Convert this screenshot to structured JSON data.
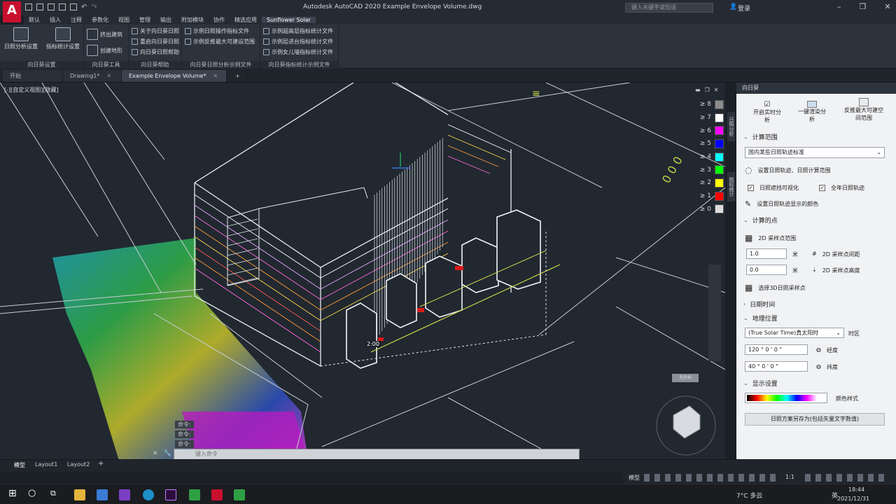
{
  "app": {
    "title": "Autodesk AutoCAD 2020    Example Envelope Volume.dwg",
    "logo_letter": "A",
    "search_placeholder": "键入关键字或短语",
    "login": "登录"
  },
  "menu": [
    "默认",
    "插入",
    "注释",
    "参数化",
    "视图",
    "管理",
    "输出",
    "附加模块",
    "协作",
    "精选应用",
    "Sunflower Solar"
  ],
  "ribbon": {
    "panel1": {
      "title": "向日葵设置",
      "btn1": "日照分析设置",
      "btn2": "指标统计设置"
    },
    "panel2": {
      "title": "向日葵工具",
      "btn1": "挤出建筑",
      "btn2": "创建地形"
    },
    "panel3": {
      "title": "向日葵帮助",
      "items": [
        "关于向日葵日照",
        "重启向日葵日照",
        "向日葵日照帮助"
      ]
    },
    "panel4": {
      "title": "向日葵日照分析示例文件",
      "items": [
        "示例日照操作指标文件",
        "示例反推最大可建设范围"
      ]
    },
    "panel5": {
      "title": "向日葵指标统计示例文件",
      "items": [
        "示例超高层指标统计文件",
        "示例层进台指标统计文件",
        "示例女儿墙指标统计文件"
      ]
    }
  },
  "tabs": [
    {
      "label": "开始",
      "active": false
    },
    {
      "label": "Drawing1*",
      "active": false
    },
    {
      "label": "Example Envelope Volume*",
      "active": true
    }
  ],
  "viewport": {
    "view_label": "[-][自定义视图][隐藏]",
    "time_label": "2:00",
    "nav_label": "无坐标",
    "legend": [
      {
        "label": "≥ 8",
        "color": "#8c8c8c"
      },
      {
        "label": "≥ 7",
        "color": "#ffffff"
      },
      {
        "label": "≥ 6",
        "color": "#ff00ff"
      },
      {
        "label": "≥ 5",
        "color": "#0000ff"
      },
      {
        "label": "≥ 4",
        "color": "#00ffff"
      },
      {
        "label": "≥ 3",
        "color": "#00ff00"
      },
      {
        "label": "≥ 2",
        "color": "#ffff00"
      },
      {
        "label": "≥ 1",
        "color": "#ff0000"
      },
      {
        "label": "≥ 0",
        "color": "#dcdcdc"
      }
    ]
  },
  "command": {
    "history": [
      "命令:",
      "命令:",
      "命令:"
    ],
    "placeholder": "键入命令"
  },
  "layout_tabs": [
    "模型",
    "Layout1",
    "Layout2"
  ],
  "status": {
    "model": "模型",
    "scale": "1:1"
  },
  "side_panel": {
    "title": "向日葵",
    "vtabs": [
      "日照分析",
      "指标统计"
    ],
    "top_buttons": [
      "开启实时分析",
      "一键渲染分析",
      "反推最大可建空间范围"
    ],
    "sec_calc_range": "计算范围",
    "standard_select": "国内某些日照轨迹标准",
    "set_track": "设置日照轨迹、日照计算范围",
    "track_visible": "日照遮挡可视化",
    "full_year": "全年日照轨迹",
    "set_color": "设置日照轨迹显示的颜色",
    "sec_points": "计算的点",
    "range_2d": "2D 采样点范围",
    "spacing_val": "1.0",
    "spacing_unit": "米",
    "spacing_label": "2D 采样点间距",
    "height_val": "0.0",
    "height_unit": "米",
    "height_label": "2D 采样点高度",
    "pick_3d": "选择3D日照采样点",
    "sec_date": "日期时间",
    "sec_geo": "地理位置",
    "tz_select": "(True  Solar  Time)真太阳时",
    "tz_label": "时区",
    "lon_val": "120  °  0  '  0  \"",
    "lon_label": "经度",
    "lat_val": "40  °  0  '  0  \"",
    "lat_label": "纬度",
    "sec_display": "显示设置",
    "color_style": "颜色样式",
    "save_btn": "日照方案另存为(包括矢量文字数值)"
  },
  "taskbar": {
    "weather": "7°C 多云",
    "time": "18:44",
    "date": "2021/12/31",
    "ime": "英"
  }
}
